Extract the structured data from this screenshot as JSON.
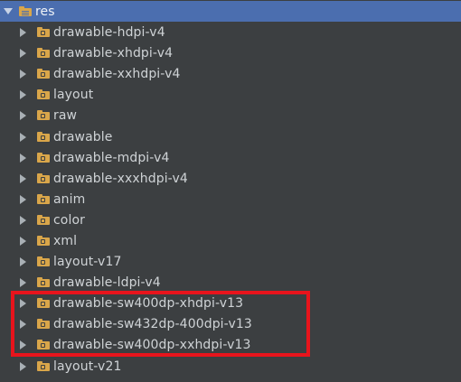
{
  "tree": {
    "root": {
      "label": "res",
      "icon": "resource-folder-icon",
      "expanded": true,
      "selected": true
    },
    "items": [
      {
        "label": "drawable-hdpi-v4",
        "icon": "folder-icon"
      },
      {
        "label": "drawable-xhdpi-v4",
        "icon": "folder-icon"
      },
      {
        "label": "drawable-xxhdpi-v4",
        "icon": "folder-icon"
      },
      {
        "label": "layout",
        "icon": "folder-icon"
      },
      {
        "label": "raw",
        "icon": "folder-icon"
      },
      {
        "label": "drawable",
        "icon": "folder-icon"
      },
      {
        "label": "drawable-mdpi-v4",
        "icon": "folder-icon"
      },
      {
        "label": "drawable-xxxhdpi-v4",
        "icon": "folder-icon"
      },
      {
        "label": "anim",
        "icon": "folder-icon"
      },
      {
        "label": "color",
        "icon": "folder-icon"
      },
      {
        "label": "xml",
        "icon": "folder-icon"
      },
      {
        "label": "layout-v17",
        "icon": "folder-icon"
      },
      {
        "label": "drawable-ldpi-v4",
        "icon": "folder-icon"
      },
      {
        "label": "drawable-sw400dp-xhdpi-v13",
        "icon": "folder-icon"
      },
      {
        "label": "drawable-sw432dp-400dpi-v13",
        "icon": "folder-icon"
      },
      {
        "label": "drawable-sw400dp-xxhdpi-v13",
        "icon": "folder-icon"
      },
      {
        "label": "layout-v21",
        "icon": "folder-icon"
      }
    ]
  },
  "colors": {
    "background": "#3c3f41",
    "selection": "#4b6eaf",
    "folder": "#d9a64a",
    "text": "#cfd3d6",
    "highlight_box": "#e8141c"
  }
}
